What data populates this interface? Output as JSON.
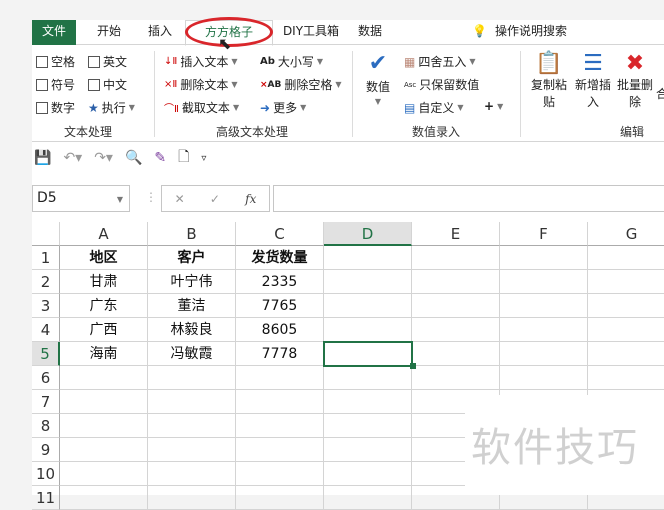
{
  "tabs": [
    "文件",
    "开始",
    "插入",
    "方方格子",
    "DIY工具箱",
    "数据"
  ],
  "tell_me": "操作说明搜索",
  "ribbon": {
    "text_group": {
      "label": "文本处理",
      "items": [
        "空格",
        "英文",
        "符号",
        "中文",
        "数字",
        "执行"
      ]
    },
    "adv_group": {
      "label": "高级文本处理",
      "items": [
        "插入文本",
        "删除文本",
        "截取文本",
        "大小写",
        "删除空格",
        "更多"
      ]
    },
    "num_group": {
      "label": "数值录入",
      "big": "数值",
      "items": [
        "四舍五入",
        "只保留数值",
        "自定义",
        "+"
      ]
    },
    "edit_group": {
      "label": "编辑",
      "items": [
        "复制粘贴",
        "新增插入",
        "批量删除",
        "合"
      ]
    }
  },
  "name_box": "D5",
  "fx": "fx",
  "columns": [
    "A",
    "B",
    "C",
    "D",
    "E",
    "F",
    "G"
  ],
  "rows": [
    "1",
    "2",
    "3",
    "4",
    "5",
    "6",
    "7",
    "8",
    "9",
    "10",
    "11"
  ],
  "cells": [
    [
      "地区",
      "客户",
      "发货数量"
    ],
    [
      "甘肃",
      "叶宁伟",
      "2335"
    ],
    [
      "广东",
      "董洁",
      "7765"
    ],
    [
      "广西",
      "林毅良",
      "8605"
    ],
    [
      "海南",
      "冯敏霞",
      "7778"
    ]
  ],
  "watermark": "软件技巧",
  "accent": "#217346"
}
